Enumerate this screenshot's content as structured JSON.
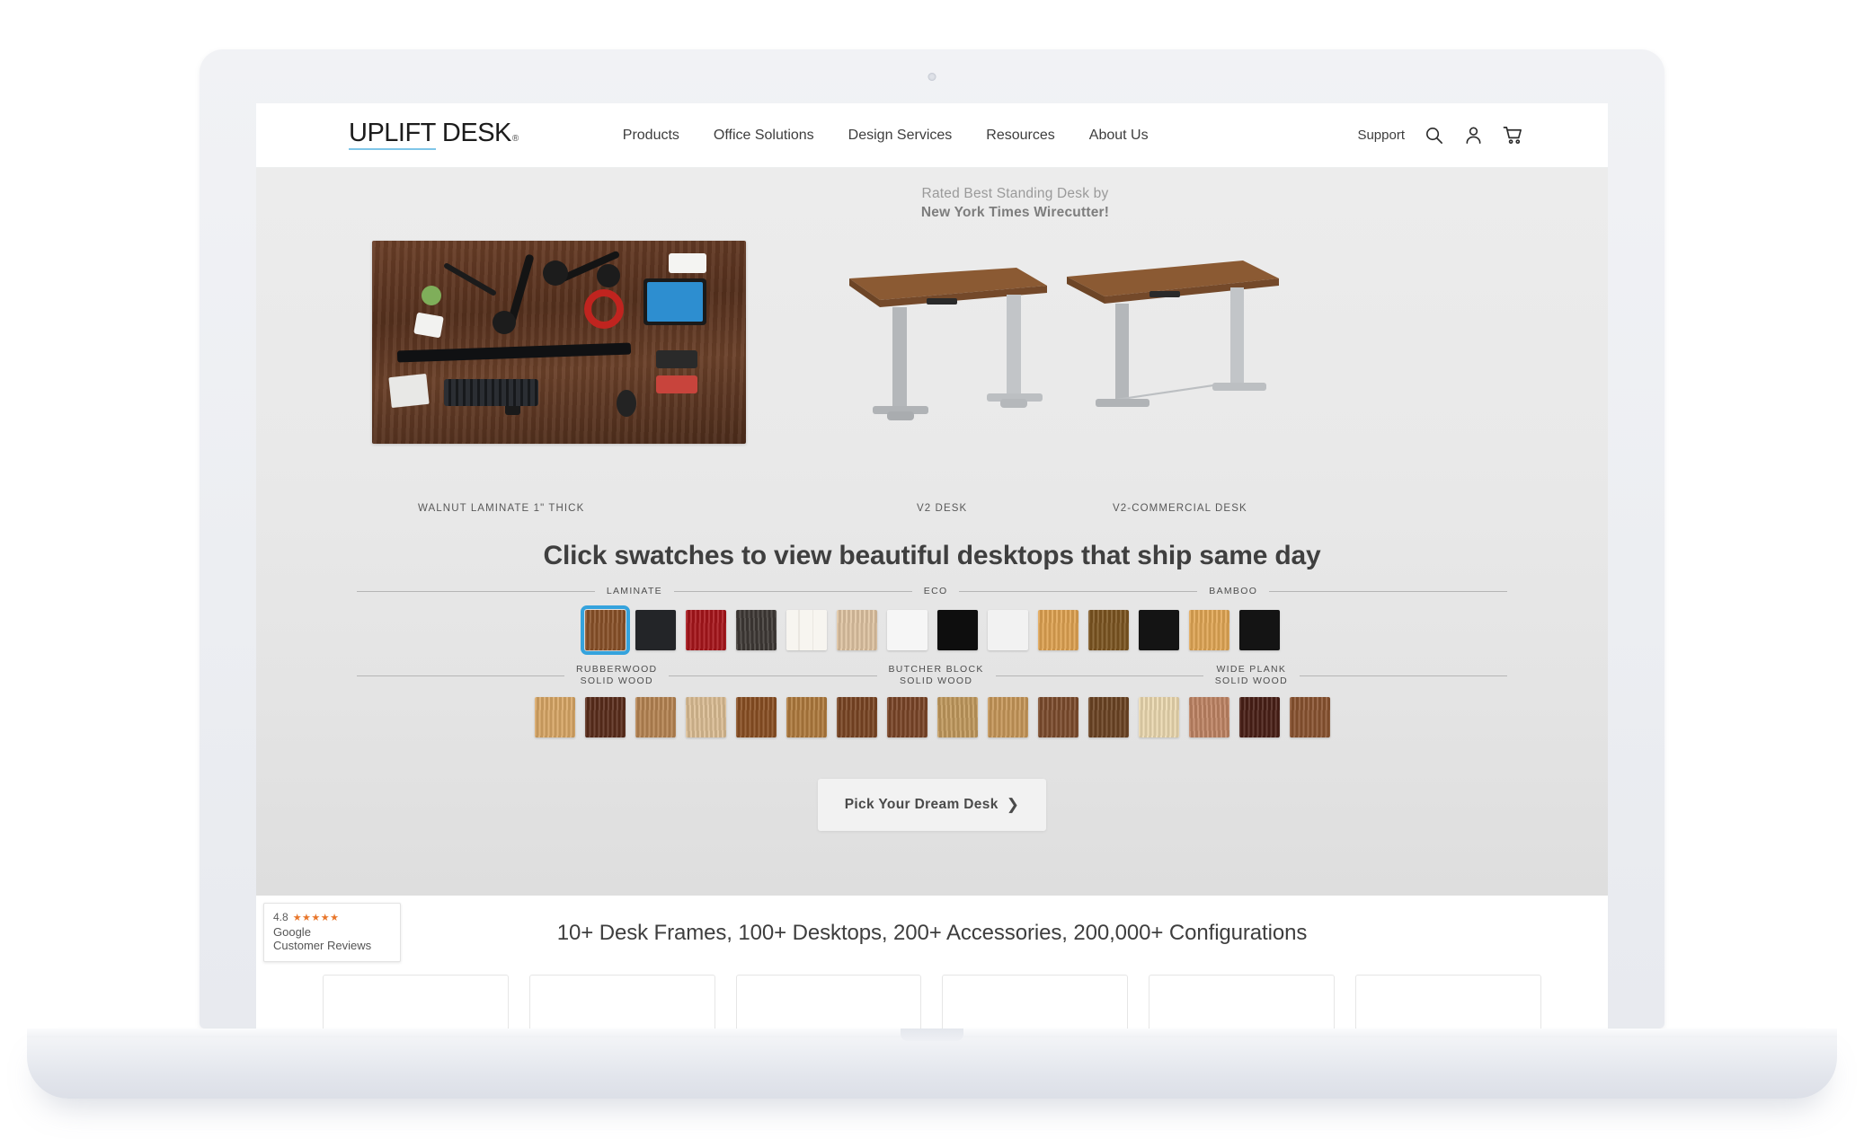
{
  "browser": {
    "device": "laptop-mockup"
  },
  "header": {
    "logo": {
      "word1": "UPLIFT",
      "word2": "DESK",
      "registered": "®"
    },
    "nav": [
      {
        "label": "Products"
      },
      {
        "label": "Office Solutions"
      },
      {
        "label": "Design Services"
      },
      {
        "label": "Resources"
      },
      {
        "label": "About Us"
      }
    ],
    "support_label": "Support",
    "icons": [
      "search-icon",
      "account-icon",
      "cart-icon"
    ]
  },
  "hero": {
    "award_line1": "Rated Best Standing Desk by",
    "award_line2": "New York Times Wirecutter!",
    "labels": [
      {
        "text": "WALNUT LAMINATE 1\" THICK"
      },
      {
        "text": "V2 DESK"
      },
      {
        "text": "V2-COMMERCIAL DESK"
      }
    ]
  },
  "swatches": {
    "headline": "Click swatches to view beautiful desktops that ship same day",
    "categories_row1": [
      {
        "label": "LAMINATE",
        "label2": ""
      },
      {
        "label": "ECO",
        "label2": ""
      },
      {
        "label": "BAMBOO",
        "label2": ""
      }
    ],
    "categories_row2": [
      {
        "label": "RUBBERWOOD",
        "label2": "SOLID WOOD"
      },
      {
        "label": "BUTCHER BLOCK",
        "label2": "SOLID WOOD"
      },
      {
        "label": "WIDE PLANK",
        "label2": "SOLID WOOD"
      }
    ],
    "selected_index": 0,
    "selection_color": "#35a3dd",
    "row1": [
      {
        "name": "walnut-laminate",
        "color": "#8a5128",
        "selected": true
      },
      {
        "name": "black-laminate",
        "color": "#232528",
        "selected": false
      },
      {
        "name": "red-laminate",
        "color": "#a8151b",
        "selected": false
      },
      {
        "name": "dark-gray-laminate",
        "color": "#3e3935",
        "selected": false
      },
      {
        "name": "swatch-sample-card",
        "color": "#f2efe9",
        "selected": false
      },
      {
        "name": "light-maple-laminate",
        "color": "#e0c4a2",
        "selected": false
      },
      {
        "name": "white-laminate",
        "color": "#f6f6f6",
        "selected": false
      },
      {
        "name": "eco-black",
        "color": "#0e0e0e",
        "selected": false
      },
      {
        "name": "eco-white",
        "color": "#f2f2f2",
        "selected": false
      },
      {
        "name": "bamboo-natural",
        "color": "#e0a351",
        "selected": false
      },
      {
        "name": "bamboo-dark",
        "color": "#7c5520",
        "selected": false
      },
      {
        "name": "bamboo-black",
        "color": "#141414",
        "selected": false
      },
      {
        "name": "bamboo-light",
        "color": "#e2a755",
        "selected": false
      },
      {
        "name": "bamboo-ebony",
        "color": "#141414",
        "selected": false
      }
    ],
    "row2": [
      {
        "name": "rubberwood-natural",
        "color": "#d9a765"
      },
      {
        "name": "rubberwood-espresso",
        "color": "#5a2c1b"
      },
      {
        "name": "butcher-block-mixed",
        "color": "#b78452"
      },
      {
        "name": "butcher-block-light",
        "color": "#dcbe94"
      },
      {
        "name": "butcher-block-knotty",
        "color": "#8a4f22"
      },
      {
        "name": "butcher-block-herringbone",
        "color": "#b07b3d"
      },
      {
        "name": "butcher-block-walnut",
        "color": "#7a4523"
      },
      {
        "name": "butcher-block-dark",
        "color": "#7b4527"
      },
      {
        "name": "wide-plank-mixed-light",
        "color": "#c29a5d"
      },
      {
        "name": "wide-plank-hickory",
        "color": "#c79759"
      },
      {
        "name": "wide-plank-walnut",
        "color": "#7d4c2d"
      },
      {
        "name": "wide-plank-acacia",
        "color": "#6c4423"
      },
      {
        "name": "wide-plank-maple",
        "color": "#ecd9b0"
      },
      {
        "name": "wide-plank-cherry",
        "color": "#c08464"
      },
      {
        "name": "wide-plank-espresso",
        "color": "#4a1f16"
      },
      {
        "name": "wide-plank-mahogany",
        "color": "#8a5330"
      }
    ],
    "cta_label": "Pick Your Dream Desk",
    "cta_chevron": "❯"
  },
  "bottom": {
    "title": "10+ Desk Frames, 100+ Desktops, 200+ Accessories, 200,000+ Configurations",
    "cards": [
      {
        "name": "card-walnut-desktop"
      },
      {
        "name": "card-dark-desktop"
      },
      {
        "name": "card-black-accessory"
      },
      {
        "name": "card-small-accessory"
      },
      {
        "name": "card-wood-frame-desk"
      },
      {
        "name": "card-white-item"
      }
    ],
    "google_badge": {
      "score": "4.8",
      "stars": "★★★★★",
      "line1": "Google",
      "line2": "Customer Reviews"
    }
  }
}
